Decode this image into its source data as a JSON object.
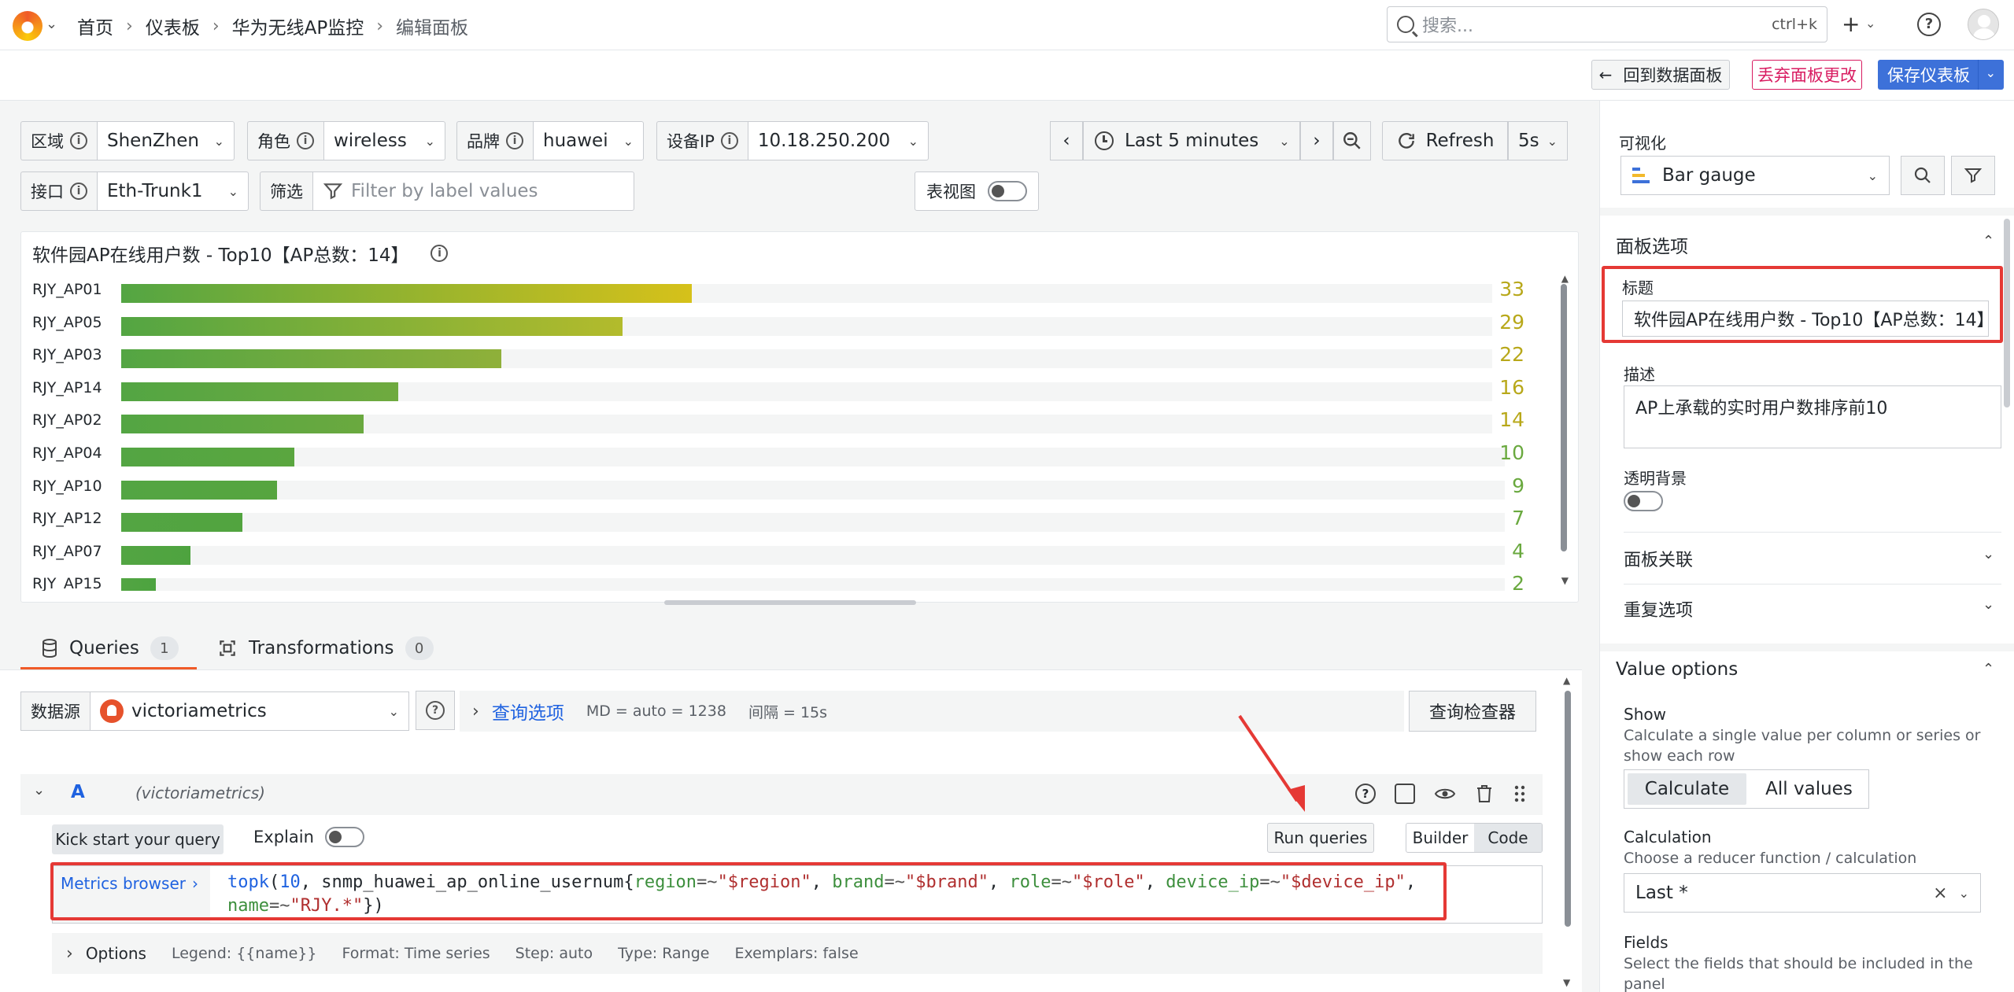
{
  "nav": {
    "breadcrumb": [
      "首页",
      "仪表板",
      "华为无线AP监控",
      "编辑面板"
    ],
    "search_placeholder": "搜索...",
    "search_shortcut": "ctrl+k"
  },
  "toolbar": {
    "back_label": "回到数据面板",
    "discard_label": "丢弃面板更改",
    "save_label": "保存仪表板"
  },
  "variables": [
    {
      "label": "区域",
      "value": "ShenZhen"
    },
    {
      "label": "角色",
      "value": "wireless"
    },
    {
      "label": "品牌",
      "value": "huawei"
    },
    {
      "label": "设备IP",
      "value": "10.18.250.200"
    },
    {
      "label": "接口",
      "value": "Eth-Trunk1"
    }
  ],
  "filter": {
    "label": "筛选",
    "placeholder": "Filter by label values"
  },
  "table_view_label": "表视图",
  "time": {
    "range": "Last 5 minutes",
    "refresh": "Refresh",
    "interval": "5s"
  },
  "panel": {
    "title": "软件园AP在线用户数 - Top10【AP总数：14】",
    "max": 80,
    "rows": [
      {
        "name": "RJY_AP01",
        "value": 33,
        "color": "#d6c11a"
      },
      {
        "name": "RJY_AP05",
        "value": 29,
        "color": "#b3bb2c"
      },
      {
        "name": "RJY_AP03",
        "value": 22,
        "color": "#8fb03a"
      },
      {
        "name": "RJY_AP14",
        "value": 16,
        "color": "#6faa3f"
      },
      {
        "name": "RJY_AP02",
        "value": 14,
        "color": "#6aa93f"
      },
      {
        "name": "RJY_AP04",
        "value": 10,
        "color": "#5aa63f"
      },
      {
        "name": "RJY_AP10",
        "value": 9,
        "color": "#56a53f"
      },
      {
        "name": "RJY_AP12",
        "value": 7,
        "color": "#52a43f"
      },
      {
        "name": "RJY_AP07",
        "value": 4,
        "color": "#4ea33f"
      },
      {
        "name": "RJY_AP15",
        "value": 2,
        "color": "#4ca33f"
      }
    ]
  },
  "query_tabs": {
    "queries_label": "Queries",
    "queries_count": "1",
    "transformations_label": "Transformations",
    "transformations_count": "0"
  },
  "datasource": {
    "label": "数据源",
    "name": "victoriametrics",
    "options_link": "查询选项",
    "md": "MD = auto = 1238",
    "interval": "间隔 = 15s",
    "inspector": "查询检查器"
  },
  "query": {
    "letter": "A",
    "ds": "(victoriametrics)",
    "kick_start": "Kick start your query",
    "explain": "Explain",
    "run": "Run queries",
    "builder": "Builder",
    "code": "Code",
    "metrics_browser": "Metrics browser",
    "options_label": "Options",
    "legend": "Legend: {{name}}",
    "format": "Format: Time series",
    "step": "Step: auto",
    "type": "Type: Range",
    "exemplars": "Exemplars: false"
  },
  "sidebar": {
    "viz_label": "可视化",
    "viz_value": "Bar gauge",
    "panel_options": "面板选项",
    "title_label": "标题",
    "title_value": "软件园AP在线用户数 - Top10【AP总数：14】",
    "desc_label": "描述",
    "desc_value": "AP上承载的实时用户数排序前10",
    "transparent_label": "透明背景",
    "panel_links": "面板关联",
    "repeat_options": "重复选项",
    "value_options": "Value options",
    "show_label": "Show",
    "show_desc": "Calculate a single value per column or series or show each row",
    "show_opt1": "Calculate",
    "show_opt2": "All values",
    "calc_label": "Calculation",
    "calc_desc": "Choose a reducer function / calculation",
    "calc_value": "Last *",
    "fields_label": "Fields",
    "fields_desc": "Select the fields that should be included in the panel"
  }
}
